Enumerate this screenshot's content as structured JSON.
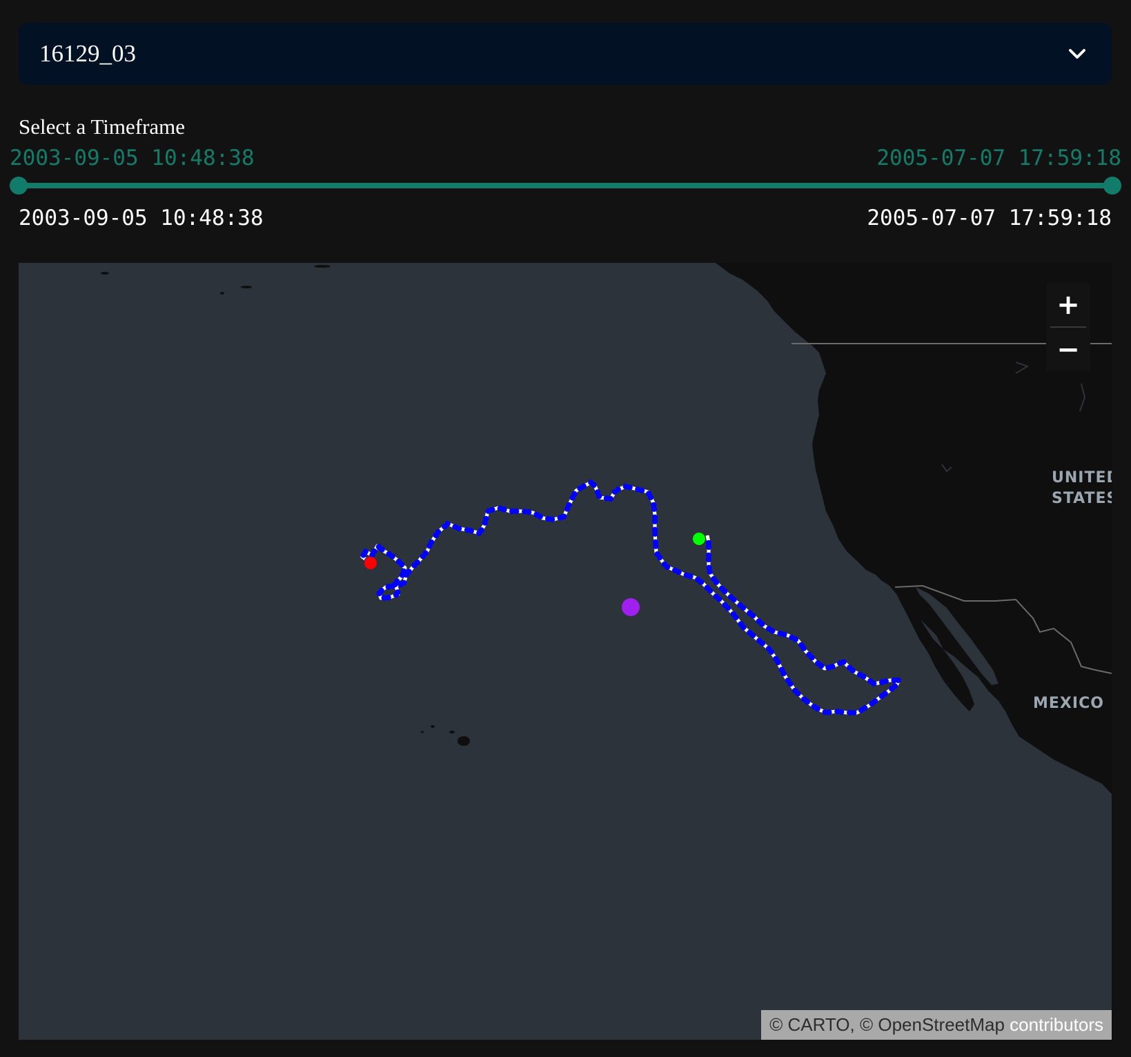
{
  "dropdown": {
    "selected": "16129_03"
  },
  "timeframe": {
    "label": "Select a Timeframe",
    "slider_min": "2003-09-05 10:48:38",
    "slider_max": "2005-07-07 17:59:18",
    "range_start": "2003-09-05 10:48:38",
    "range_end": "2005-07-07 17:59:18"
  },
  "map": {
    "zoom_in": "+",
    "zoom_out": "−",
    "labels": {
      "united_states": "UNITED STATES",
      "mexico": "MEXICO"
    },
    "attribution": {
      "carto": "© CARTO, © OpenStreetMap",
      "contributors": "contributors"
    },
    "colors": {
      "ocean": "#2c333b",
      "land": "#0f0f0f",
      "track_dots": "#0000ff",
      "track_line": "#ffffff",
      "start_marker": "#ff0000",
      "end_marker": "#00ff00",
      "center_marker": "#a020f0"
    }
  }
}
